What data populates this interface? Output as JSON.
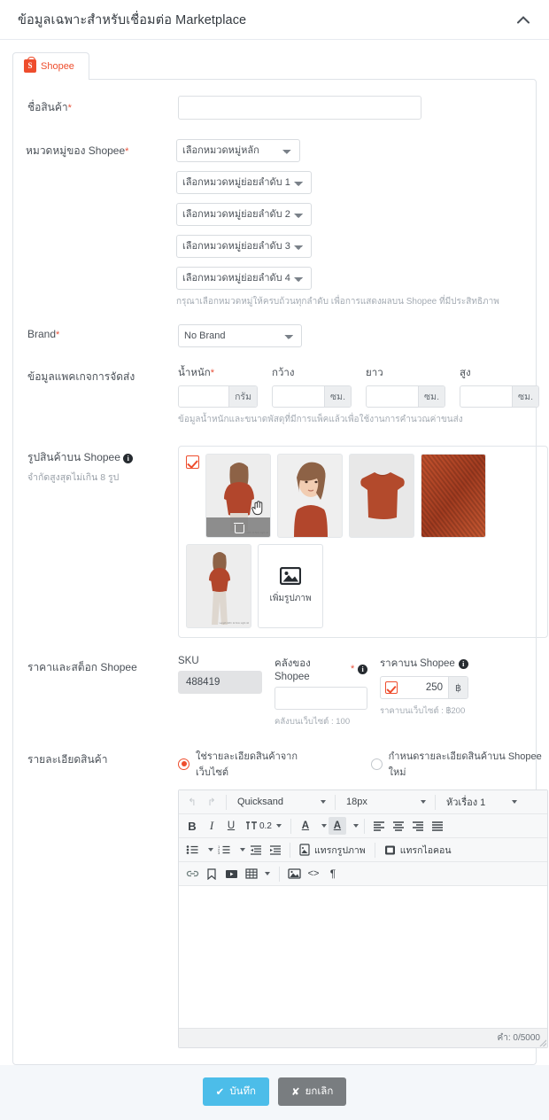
{
  "header": {
    "title": "ข้อมูลเฉพาะสำหรับเชื่อมต่อ Marketplace",
    "collapse_icon": "chevron-up-icon"
  },
  "tab": {
    "label": "Shopee",
    "icon": "shopee-bag-icon"
  },
  "product_name": {
    "label": "ชื่อสินค้า",
    "required": "*",
    "value": "",
    "placeholder": ""
  },
  "category": {
    "label": "หมวดหมู่ของ Shopee",
    "required": "*",
    "main": "เลือกหมวดหมู่หลัก",
    "sub1": "เลือกหมวดหมู่ย่อยลำดับ 1",
    "sub2": "เลือกหมวดหมู่ย่อยลำดับ 2",
    "sub3": "เลือกหมวดหมู่ย่อยลำดับ 3",
    "sub4": "เลือกหมวดหมู่ย่อยลำดับ 4",
    "hint": "กรุณาเลือกหมวดหมู่ให้ครบถ้วนทุกลำดับ เพื่อการแสดงผลบน Shopee ที่มีประสิทธิภาพ"
  },
  "brand": {
    "label": "Brand",
    "required": "*",
    "value": "No Brand"
  },
  "package": {
    "label": "ข้อมูลแพคเกจการจัดส่ง",
    "hint": "ข้อมูลน้ำหนักและขนาดพัสดุที่มีการแพ็คแล้วเพื่อใช้งานการคำนวณค่าขนส่ง",
    "fields": [
      {
        "caption": "น้ำหนัก",
        "required": "*",
        "unit": "กรัม",
        "value": ""
      },
      {
        "caption": "กว้าง",
        "required": "",
        "unit": "ซม.",
        "value": ""
      },
      {
        "caption": "ยาว",
        "required": "",
        "unit": "ซม.",
        "value": ""
      },
      {
        "caption": "สูง",
        "required": "",
        "unit": "ซม.",
        "value": ""
      }
    ]
  },
  "images": {
    "label": "รูปสินค้าบน Shopee",
    "info_icon": "info-icon",
    "sub": "จำกัดสูงสุดไม่เกิน 8 รูป",
    "select_all_checked": true,
    "add_label": "เพิ่มรูปภาพ",
    "add_icon": "image-add-icon",
    "delete_icon": "trash-icon",
    "cursor_icon": "hand-cursor-icon",
    "thumb_tag": "Length 108 / 11.5cm\nLight 44"
  },
  "price_stock": {
    "label": "ราคาและสต็อก Shopee",
    "sku_caption": "SKU",
    "sku_value": "488419",
    "stock_caption": "คลังของ Shopee",
    "stock_required": "*",
    "stock_value": "",
    "stock_note": "คลังบนเว็บไซต์ : 100",
    "price_caption": "ราคาบน Shopee",
    "price_value": "250",
    "price_unit": "฿",
    "price_note": "ราคาบนเว็บไซต์ : ฿200",
    "price_checked": true
  },
  "description": {
    "label": "รายละเอียดสินค้า",
    "option_site": "ใช่รายละเอียดสินค้าจากเว็บไซต์",
    "option_new": "กำหนดรายละเอียดสินค้าบน Shopee ใหม่",
    "selected": "site",
    "editor": {
      "undo_icon": "undo-icon",
      "redo_icon": "redo-icon",
      "font_family": "Quicksand",
      "font_size": "18px",
      "heading": "หัวเรื่อง 1",
      "bold": "B",
      "italic": "I",
      "underline": "U",
      "letter_spacing_icon": "letter-spacing-icon",
      "letter_spacing_value": "0.2",
      "text_color_icon": "text-color-icon",
      "highlight_icon": "highlight-color-icon",
      "align_left_icon": "align-left-icon",
      "align_center_icon": "align-center-icon",
      "align_right_icon": "align-right-icon",
      "align_justify_icon": "align-justify-icon",
      "bullet_list_icon": "bullet-list-icon",
      "number_list_icon": "numbered-list-icon",
      "outdent_icon": "outdent-icon",
      "indent_icon": "indent-icon",
      "insert_image_label": "แทรกรูปภาพ",
      "insert_image_icon": "insert-image-icon",
      "insert_icon_label": "แทรกไอคอน",
      "insert_icon_icon": "insert-icon-icon",
      "link_icon": "link-icon",
      "bookmark_icon": "bookmark-icon",
      "video_icon": "video-icon",
      "table_icon": "table-icon",
      "media_icon": "media-icon",
      "code_icon": "code-icon",
      "paragraph_icon": "pilcrow-icon",
      "content": "",
      "counter": "คำ: 0/5000"
    }
  },
  "footer": {
    "save_label": "บันทึก",
    "save_icon": "check-icon",
    "cancel_label": "ยกเลิก",
    "cancel_icon": "x-icon"
  },
  "colors": {
    "accent": "#ee4d2d",
    "save": "#4cbde9",
    "cancel": "#797d80",
    "required": "#e8513a"
  }
}
